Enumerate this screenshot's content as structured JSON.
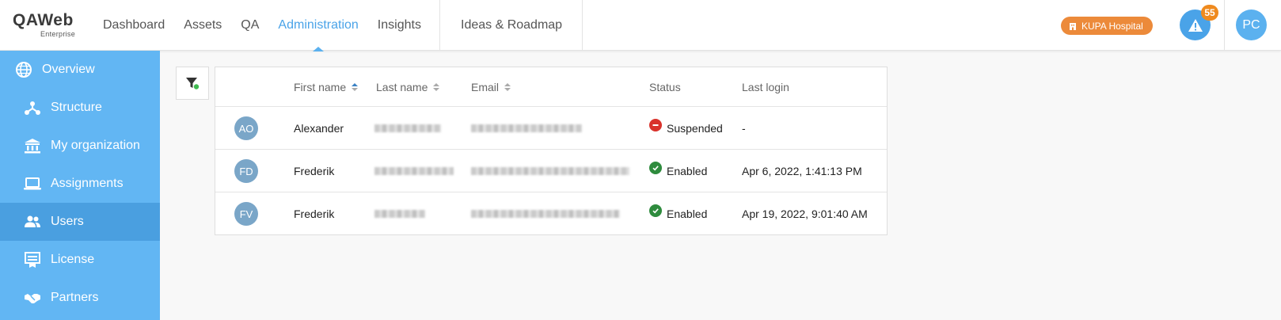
{
  "header": {
    "logo_main": "QAWeb",
    "logo_sub": "Enterprise",
    "nav": [
      "Dashboard",
      "Assets",
      "QA",
      "Administration",
      "Insights"
    ],
    "nav_active": "Administration",
    "roadmap": "Ideas & Roadmap",
    "organization": "KUPA Hospital",
    "alert_count": "55",
    "user_initials": "PC"
  },
  "sidebar": {
    "items": [
      {
        "label": "Overview",
        "icon": "globe-icon",
        "level": "top"
      },
      {
        "label": "Structure",
        "icon": "structure-icon",
        "level": "sub"
      },
      {
        "label": "My organization",
        "icon": "institution-icon",
        "level": "sub"
      },
      {
        "label": "Assignments",
        "icon": "laptop-icon",
        "level": "sub"
      },
      {
        "label": "Users",
        "icon": "users-icon",
        "level": "sub",
        "active": true
      },
      {
        "label": "License",
        "icon": "license-icon",
        "level": "sub"
      },
      {
        "label": "Partners",
        "icon": "handshake-icon",
        "level": "sub"
      }
    ]
  },
  "table": {
    "columns": {
      "first_name": "First name",
      "last_name": "Last name",
      "email": "Email",
      "status": "Status",
      "last_login": "Last login"
    },
    "rows": [
      {
        "initials": "AO",
        "first_name": "Alexander",
        "status": "Suspended",
        "status_type": "suspended",
        "last_login": "-"
      },
      {
        "initials": "FD",
        "first_name": "Frederik",
        "status": "Enabled",
        "status_type": "enabled",
        "last_login": "Apr 6, 2022, 1:41:13 PM"
      },
      {
        "initials": "FV",
        "first_name": "Frederik",
        "status": "Enabled",
        "status_type": "enabled",
        "last_login": "Apr 19, 2022, 9:01:40 AM"
      }
    ]
  },
  "colors": {
    "accent": "#4aa3e8",
    "sidebar": "#62b6f3",
    "sidebar_active": "#4a9fe0",
    "org_badge": "#ec8a3a",
    "alert_badge": "#ef8a1e",
    "suspended": "#d9322b",
    "enabled": "#2e8b3d"
  }
}
